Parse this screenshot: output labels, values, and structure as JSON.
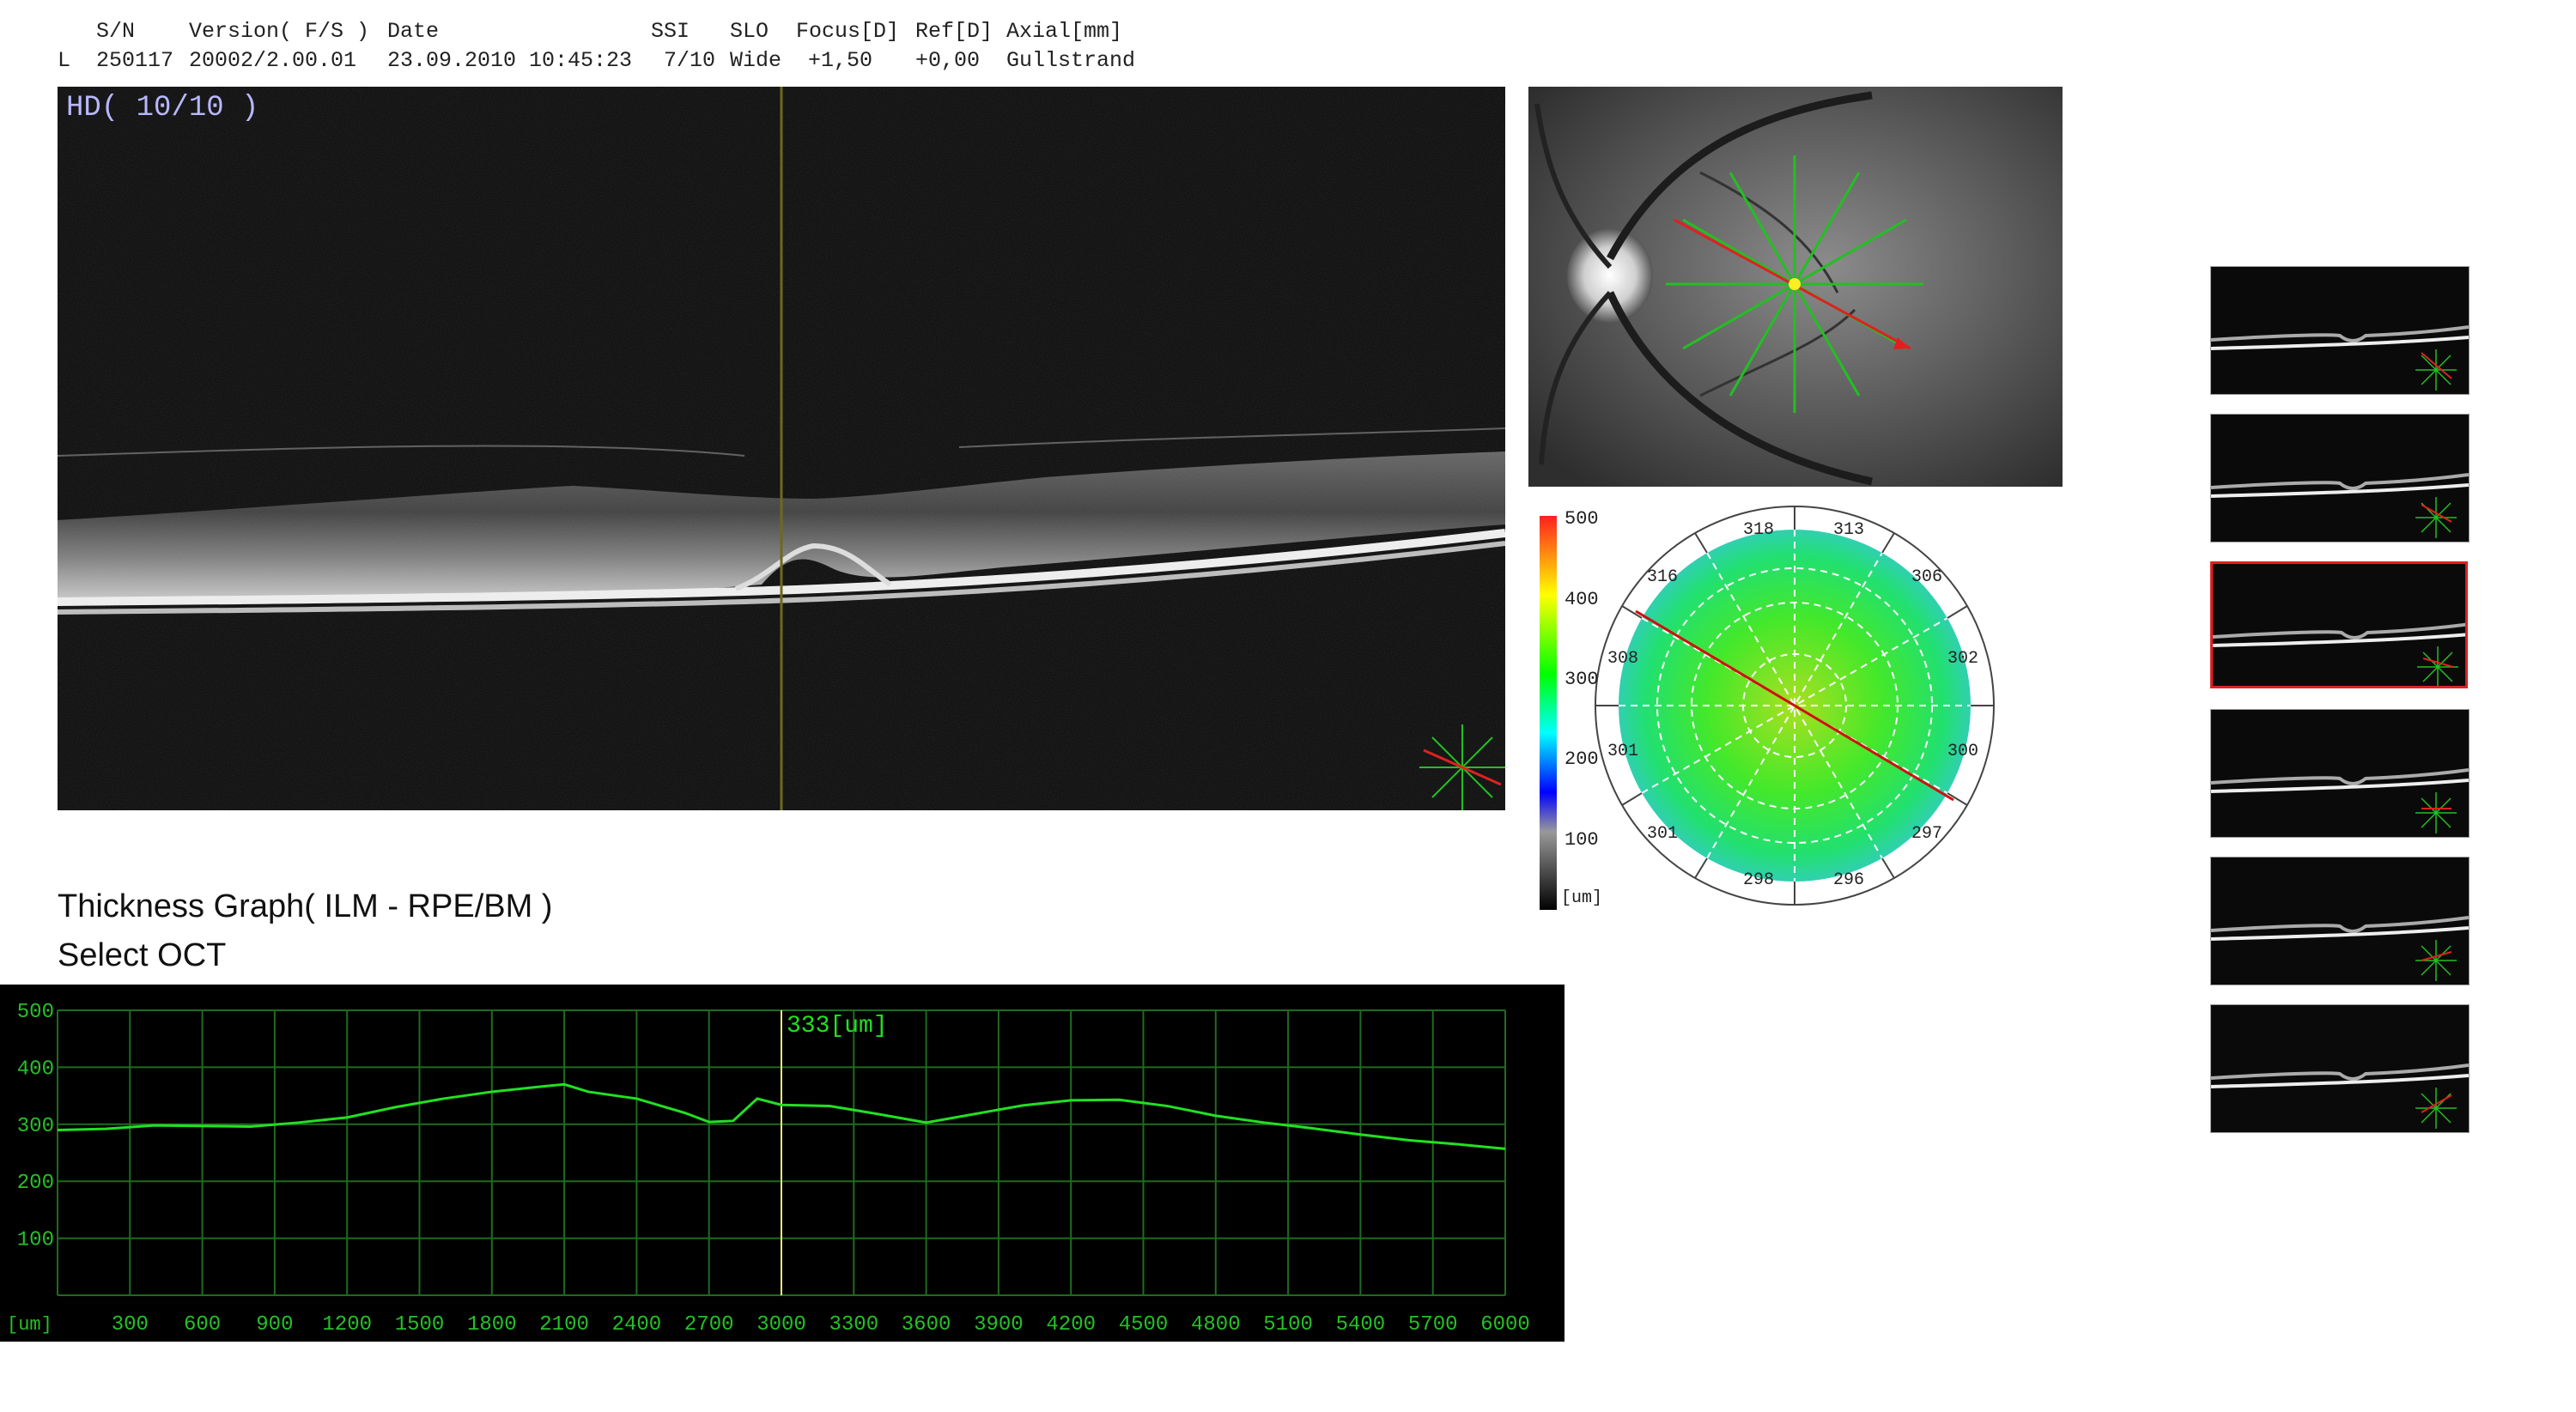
{
  "header": {
    "columns": [
      {
        "label": "S/N",
        "value": "250117"
      },
      {
        "label": "Version( F/S )",
        "value": "20002/2.00.01"
      },
      {
        "label": "Date",
        "value": "23.09.2010 10:45:23"
      },
      {
        "label": "SSI",
        "value": "7/10"
      },
      {
        "label": "SLO",
        "value": "Wide"
      },
      {
        "label": "Focus[D]",
        "value": "+1,50"
      },
      {
        "label": "Ref[D]",
        "value": "+0,00"
      },
      {
        "label": "Axial[mm]",
        "value": "Gullstrand"
      }
    ],
    "eye": "L"
  },
  "main_oct": {
    "label": "HD( 10/10 )"
  },
  "thickness_map": {
    "scale_labels": [
      "500",
      "400",
      "300",
      "200",
      "100",
      "[um]"
    ],
    "sector_values": [
      "318",
      "313",
      "306",
      "302",
      "300",
      "297",
      "296",
      "298",
      "301",
      "301",
      "308",
      "316"
    ]
  },
  "graph": {
    "title": "Thickness Graph( ILM - RPE/BM )",
    "subtitle": "Select OCT",
    "cursor_readout": "333[um]"
  },
  "chart_data": {
    "type": "line",
    "title": "",
    "xlabel": "[um]",
    "ylabel": "",
    "xlim": [
      0,
      6000
    ],
    "ylim": [
      0,
      500
    ],
    "x_ticks": [
      300,
      600,
      900,
      1200,
      1500,
      1800,
      2100,
      2400,
      2700,
      3000,
      3300,
      3600,
      3900,
      4200,
      4500,
      4800,
      5100,
      5400,
      5700,
      6000
    ],
    "y_ticks": [
      100,
      200,
      300,
      400,
      500
    ],
    "grid": true,
    "cursor_x": 3000,
    "series": [
      {
        "color": "#22e022",
        "x": [
          0,
          200,
          400,
          600,
          800,
          1000,
          1200,
          1400,
          1600,
          1800,
          2000,
          2100,
          2200,
          2400,
          2600,
          2700,
          2800,
          2900,
          3000,
          3200,
          3400,
          3600,
          3800,
          4000,
          4200,
          4400,
          4600,
          4800,
          5000,
          5200,
          5400,
          5600,
          5800,
          6000
        ],
        "y": [
          290,
          292,
          298,
          297,
          296,
          303,
          312,
          330,
          345,
          357,
          366,
          370,
          357,
          345,
          320,
          304,
          306,
          345,
          334,
          332,
          318,
          303,
          318,
          333,
          342,
          343,
          332,
          315,
          303,
          293,
          282,
          272,
          265,
          257
        ]
      }
    ]
  },
  "colors": {
    "graph_line": "#22e022",
    "grid": "#1f6b1f",
    "axis_text": "#26c026",
    "selected_border": "#e02020",
    "scan_arrow": "#e02020",
    "scan_lines": "#22c022"
  },
  "thumbnails": {
    "count": 6,
    "selected_index": 2
  }
}
